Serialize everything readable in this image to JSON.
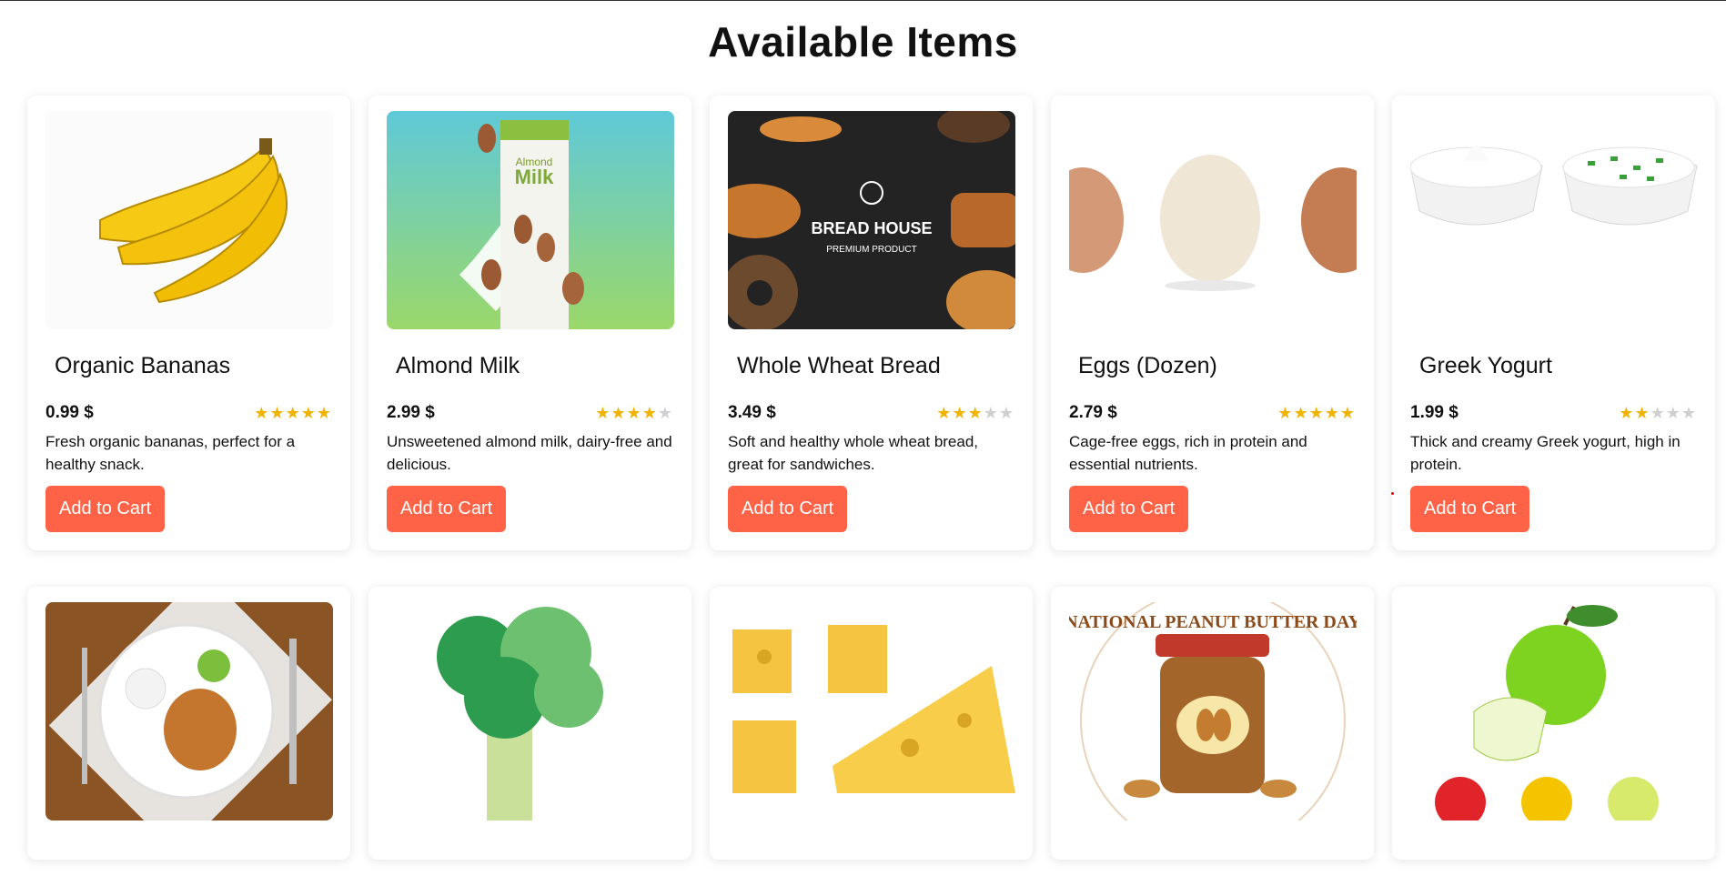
{
  "page": {
    "title": "Available Items"
  },
  "colors": {
    "button": "#ff6347",
    "star_on": "#f0b400",
    "star_off": "#cfcfcf"
  },
  "products": [
    {
      "name": "Organic Bananas",
      "price": "0.99 $",
      "rating": 5,
      "description": "Fresh organic bananas, perfect for a healthy snack.",
      "button": "Add to Cart",
      "image": "bananas"
    },
    {
      "name": "Almond Milk",
      "price": "2.99 $",
      "rating": 4,
      "description": "Unsweetened almond milk, dairy-free and delicious.",
      "button": "Add to Cart",
      "image": "almond-milk",
      "image_text": {
        "line1": "Almond",
        "line2": "Milk"
      }
    },
    {
      "name": "Whole Wheat Bread",
      "price": "3.49 $",
      "rating": 3,
      "description": "Soft and healthy whole wheat bread, great for sandwiches.",
      "button": "Add to Cart",
      "image": "bread",
      "image_text": {
        "line1": "BREAD HOUSE",
        "line2": "PREMIUM PRODUCT"
      }
    },
    {
      "name": "Eggs (Dozen)",
      "price": "2.79 $",
      "rating": 5,
      "description": "Cage-free eggs, rich in protein and essential nutrients.",
      "button": "Add to Cart",
      "image": "eggs"
    },
    {
      "name": "Greek Yogurt",
      "price": "1.99 $",
      "rating": 2,
      "description": "Thick and creamy Greek yogurt, high in protein.",
      "button": "Add to Cart",
      "image": "yogurt"
    }
  ],
  "second_row_images": [
    "chicken-plate",
    "broccoli",
    "cheese",
    "peanut-butter",
    "apples"
  ],
  "peanut_text": "NATIONAL PEANUT BUTTER DAY"
}
